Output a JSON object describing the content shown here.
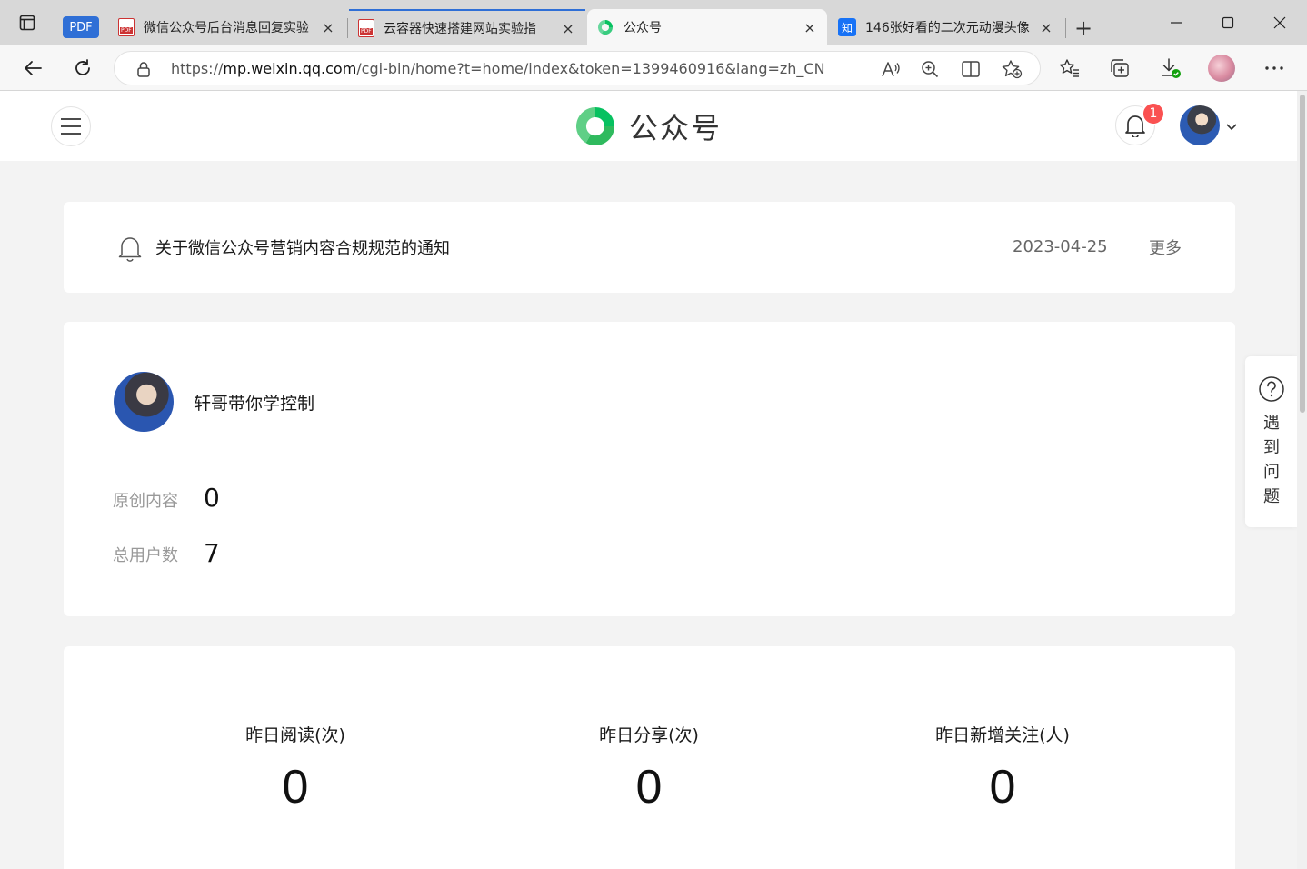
{
  "browser": {
    "pdf_pill": "PDF",
    "tabs": [
      {
        "title": "微信公众号后台消息回复实验",
        "icon": "pdf-icon"
      },
      {
        "title": "云容器快速搭建网站实验指",
        "icon": "pdf-icon"
      },
      {
        "title": "公众号",
        "icon": "wechat-mp-icon",
        "active": true
      },
      {
        "title": "146张好看的二次元动漫头像",
        "icon": "zhihu-icon",
        "icon_text": "知"
      }
    ],
    "close_glyph": "×",
    "new_tab_glyph": "+",
    "url_prefix": "https://",
    "url_host": "mp.weixin.qq.com",
    "url_path": "/cgi-bin/home?t=home/index&token=1399460916&lang=zh_CN"
  },
  "header": {
    "brand_name": "公众号",
    "notification_count": "1"
  },
  "notice": {
    "title": "关于微信公众号营销内容合规规范的通知",
    "date": "2023-04-25",
    "more": "更多"
  },
  "account": {
    "name": "轩哥带你学控制",
    "stats": [
      {
        "label": "原创内容",
        "value": "0"
      },
      {
        "label": "总用户数",
        "value": "7"
      }
    ]
  },
  "metrics": [
    {
      "label": "昨日阅读(次)",
      "value": "0"
    },
    {
      "label": "昨日分享(次)",
      "value": "0"
    },
    {
      "label": "昨日新增关注(人)",
      "value": "0"
    }
  ],
  "help": {
    "label_chars": [
      "遇",
      "到",
      "问",
      "题"
    ]
  },
  "colors": {
    "brand_green": "#07c160",
    "badge_red": "#fa5151",
    "tab_strip": "#d8d8d8"
  }
}
